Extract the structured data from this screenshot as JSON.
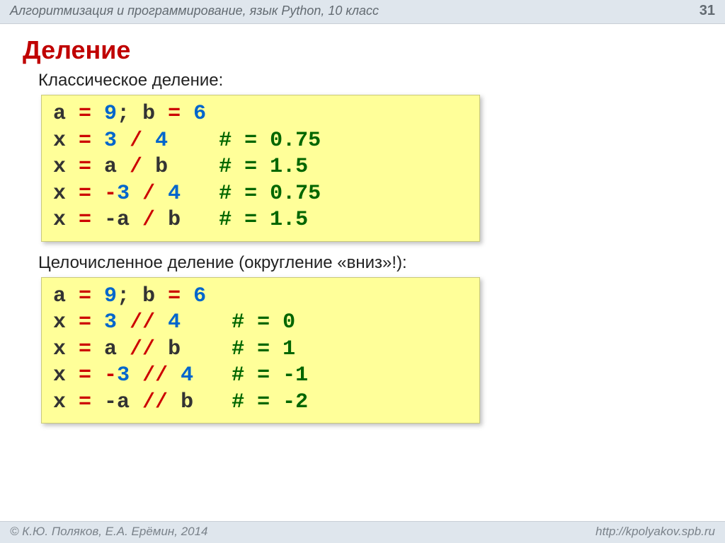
{
  "header": {
    "course": "Алгоритмизация и программирование, язык Python, 10 класс",
    "page": "31"
  },
  "title": "Деление",
  "section1_label": "Классическое деление:",
  "section2_label": "Целочисленное деление (округление «вниз»!):",
  "code1": {
    "l1_a": "a ",
    "l1_eq1": "=",
    "l1_sp1": " ",
    "l1_n1": "9",
    "l1_semi": "; b ",
    "l1_eq2": "=",
    "l1_sp2": " ",
    "l1_n2": "6",
    "l2_a": "x ",
    "l2_eq": "=",
    "l2_sp1": " ",
    "l2_n1": "3",
    "l2_sp2": " ",
    "l2_op": "/",
    "l2_sp3": " ",
    "l2_n2": "4",
    "l2_pad": "    ",
    "l2_com": "# = 0.75",
    "l3_a": "x ",
    "l3_eq": "=",
    "l3_rhs": " a ",
    "l3_op": "/",
    "l3_rhs2": " b    ",
    "l3_com": "# = 1.5",
    "l4_a": "x ",
    "l4_eq": "=",
    "l4_sp1": " ",
    "l4_neg": "-",
    "l4_n1": "3",
    "l4_sp2": " ",
    "l4_op": "/",
    "l4_sp3": " ",
    "l4_n2": "4",
    "l4_pad": "   ",
    "l4_com": "# = 0.75",
    "l5_a": "x ",
    "l5_eq": "=",
    "l5_rhs": " -a ",
    "l5_op": "/",
    "l5_rhs2": " b   ",
    "l5_com": "# = 1.5"
  },
  "code2": {
    "l1_a": "a ",
    "l1_eq1": "=",
    "l1_sp1": " ",
    "l1_n1": "9",
    "l1_semi": "; b ",
    "l1_eq2": "=",
    "l1_sp2": " ",
    "l1_n2": "6",
    "l2_a": "x ",
    "l2_eq": "=",
    "l2_sp1": " ",
    "l2_n1": "3",
    "l2_sp2": " ",
    "l2_op": "//",
    "l2_sp3": " ",
    "l2_n2": "4",
    "l2_pad": "    ",
    "l2_com": "# = 0",
    "l3_a": "x ",
    "l3_eq": "=",
    "l3_rhs": " a ",
    "l3_op": "//",
    "l3_rhs2": " b    ",
    "l3_com": "# = 1",
    "l4_a": "x ",
    "l4_eq": "=",
    "l4_sp1": " ",
    "l4_neg": "-",
    "l4_n1": "3",
    "l4_sp2": " ",
    "l4_op": "//",
    "l4_sp3": " ",
    "l4_n2": "4",
    "l4_pad": "   ",
    "l4_com": "# = -1",
    "l5_a": "x ",
    "l5_eq": "=",
    "l5_rhs": " -a ",
    "l5_op": "//",
    "l5_rhs2": " b   ",
    "l5_com": "# = -2"
  },
  "footer": {
    "copyright": "© К.Ю. Поляков, Е.А. Ерёмин, 2014",
    "url": "http://kpolyakov.spb.ru"
  }
}
